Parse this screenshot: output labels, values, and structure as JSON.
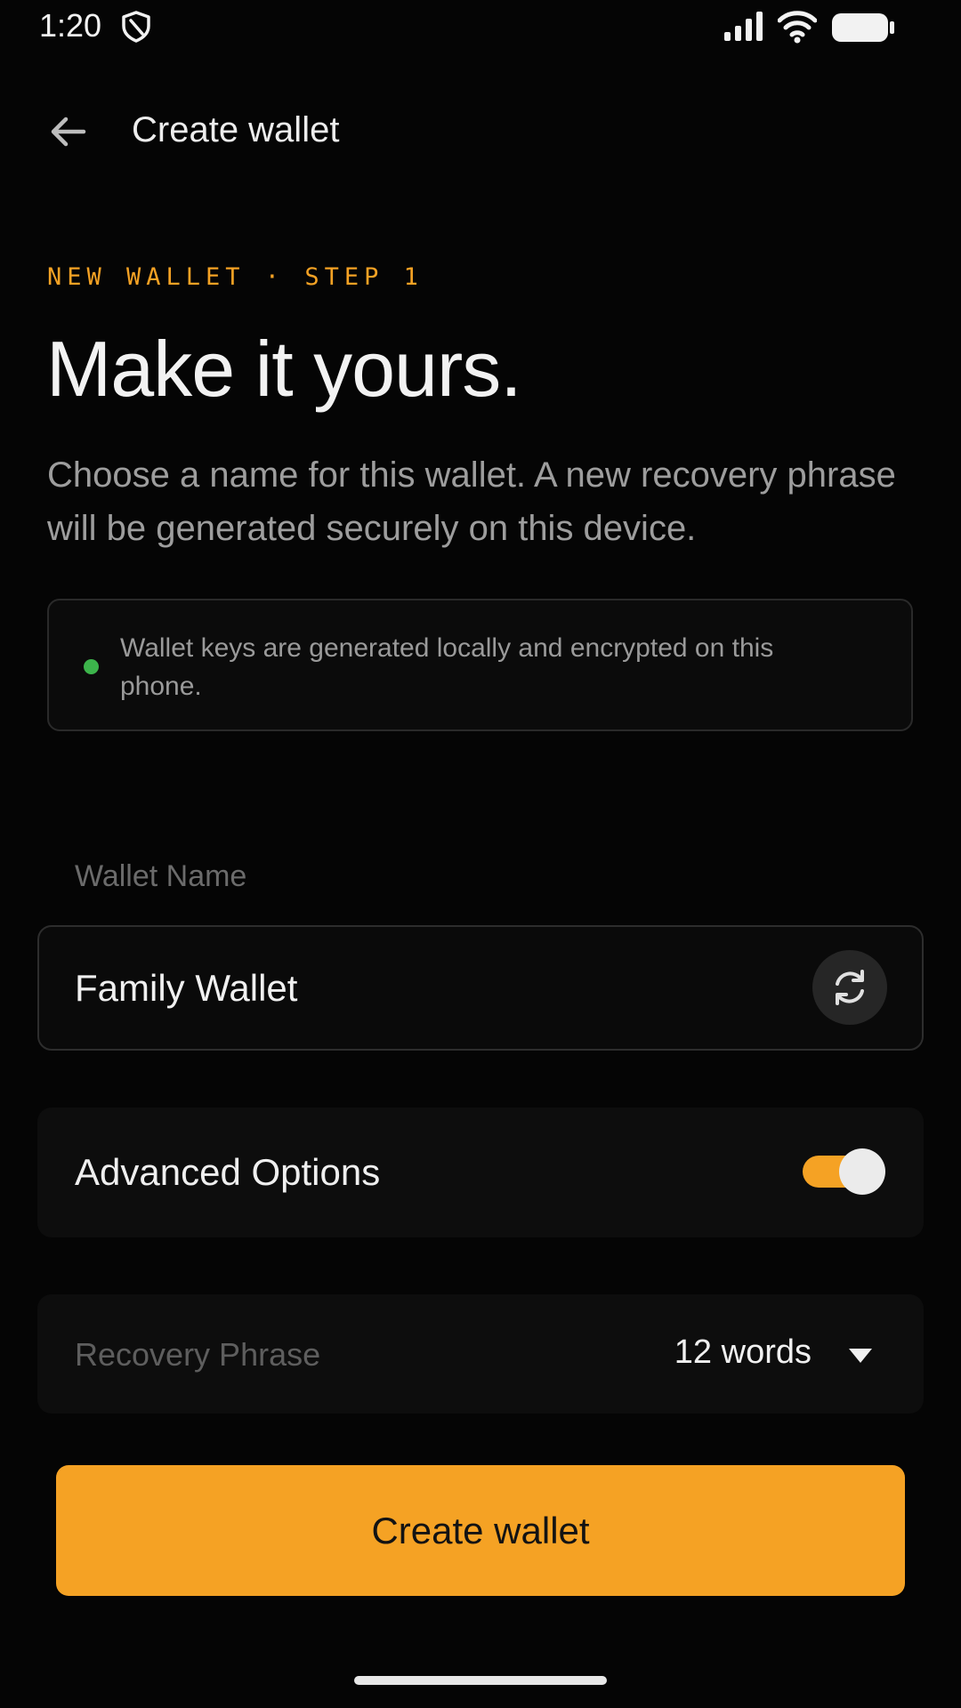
{
  "status_bar": {
    "time": "1:20",
    "icons": [
      "shield-icon",
      "signal-icon",
      "wifi-icon",
      "battery-icon"
    ]
  },
  "app_bar": {
    "back_icon": "arrow-left-icon",
    "title": "Create wallet"
  },
  "hero": {
    "step_label": "NEW WALLET · STEP 1",
    "title": "Make it yours.",
    "description": "Choose a name for this wallet. A new recovery phrase will be generated securely on this device."
  },
  "info_box": {
    "text": "Wallet keys are generated locally and encrypted on this phone.",
    "dot_color": "#3cb44b"
  },
  "wallet_name": {
    "label": "Wallet Name",
    "value": "Family Wallet",
    "regenerate_icon": "refresh-icon"
  },
  "advanced_options": {
    "label": "Advanced Options",
    "enabled": true
  },
  "recovery_phrase": {
    "label": "Recovery Phrase",
    "selected": "12 words",
    "icon": "dropdown-triangle-icon"
  },
  "primary_action": {
    "label": "Create wallet"
  },
  "colors": {
    "accent": "#f5a224",
    "background": "#050505",
    "success": "#3cb44b"
  }
}
